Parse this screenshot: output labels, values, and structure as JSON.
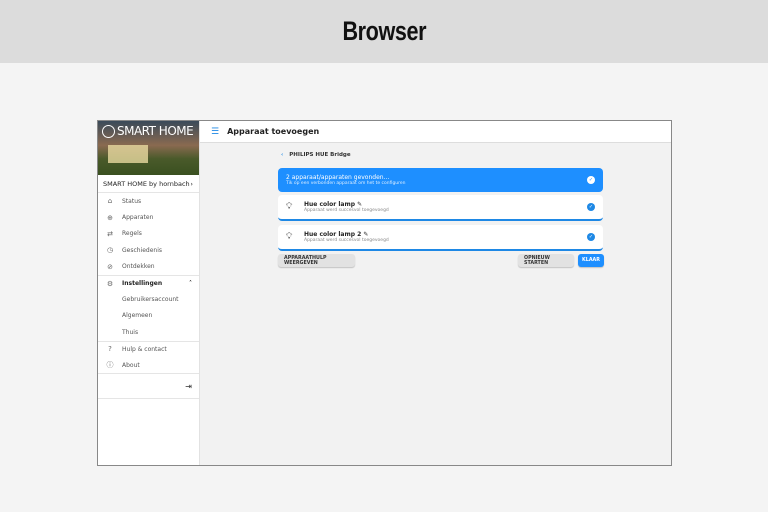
{
  "page_title": "Browser",
  "sidebar": {
    "logo_text": "SMART HOME",
    "account": "SMART HOME by hornbach",
    "items": [
      {
        "label": "Status",
        "icon": "home-icon"
      },
      {
        "label": "Apparaten",
        "icon": "devices-icon"
      },
      {
        "label": "Regels",
        "icon": "repeat-icon"
      },
      {
        "label": "Geschiedenis",
        "icon": "history-icon"
      },
      {
        "label": "Ontdekken",
        "icon": "compass-icon"
      }
    ],
    "settings": {
      "label": "Instellingen",
      "icon": "gear-icon",
      "sub": [
        "Gebruikersaccount",
        "Algemeen",
        "Thuis"
      ]
    },
    "help": "Hulp & contact",
    "about": "About"
  },
  "header": {
    "title": "Apparaat toevoegen"
  },
  "breadcrumb": "PHILIPS HUE Bridge",
  "banner": {
    "title": "2 apparaat/apparaten gevonden...",
    "subtitle": "Tik op een verbonden apparaat om het te configuren"
  },
  "devices": [
    {
      "name": "Hue color lamp",
      "status": "Apparaat werd succesvol toegevoegd"
    },
    {
      "name": "Hue color lamp 2",
      "status": "Apparaat werd succesvol toegevoegd"
    }
  ],
  "buttons": {
    "help": "APPARAATHULP WEERGEVEN",
    "restart": "OPNIEUW STARTEN",
    "done": "KLAAR"
  },
  "colors": {
    "accent": "#1e8fff"
  }
}
